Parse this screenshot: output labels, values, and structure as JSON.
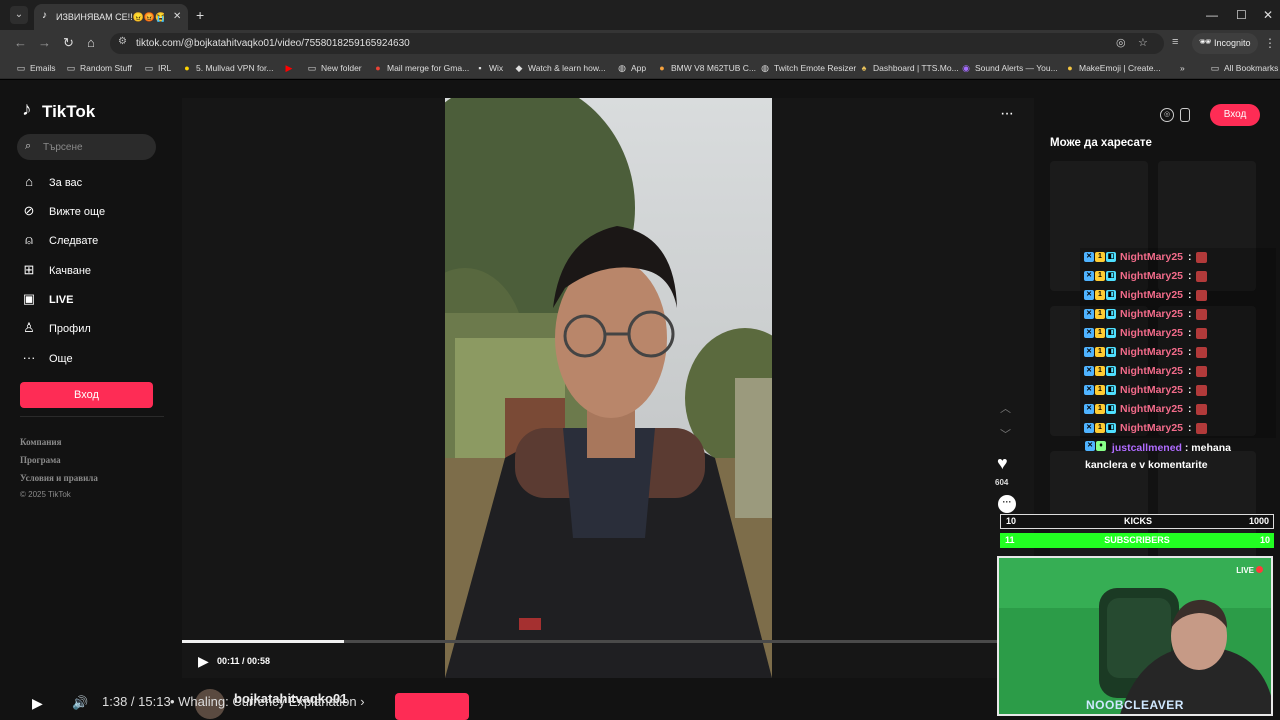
{
  "browser": {
    "tab_title": "ИЗВИНЯВАМ СЕ!!😠😡😭",
    "url": "tiktok.com/@bojkatahitvaqko01/video/7558018259165924630",
    "incognito_label": "Incognito",
    "bookmarks": [
      {
        "label": "Emails",
        "icon": "folder-icon"
      },
      {
        "label": "Random Stuff",
        "icon": "folder-icon"
      },
      {
        "label": "IRL",
        "icon": "folder-icon"
      },
      {
        "label": "5. Mullvad VPN for...",
        "icon": "mullvad-icon"
      },
      {
        "label": "",
        "icon": "youtube-icon"
      },
      {
        "label": "New folder",
        "icon": "folder-icon"
      },
      {
        "label": "Mail merge for Gma...",
        "icon": "mail-merge-icon"
      },
      {
        "label": "Wix",
        "icon": "wix-icon"
      },
      {
        "label": "Watch & learn how...",
        "icon": "watch-icon"
      },
      {
        "label": "App",
        "icon": "globe-icon"
      },
      {
        "label": "BMW V8 M62TUB C...",
        "icon": "bmw-icon"
      },
      {
        "label": "Twitch Emote Resizer",
        "icon": "twitch-icon"
      },
      {
        "label": "Dashboard | TTS.Mo...",
        "icon": "tts-icon"
      },
      {
        "label": "Sound Alerts — You...",
        "icon": "sound-alerts-icon"
      },
      {
        "label": "MakeEmoji | Create...",
        "icon": "makeemoji-icon"
      }
    ],
    "all_bookmarks": "All Bookmarks"
  },
  "sidebar": {
    "logo": "TikTok",
    "search_placeholder": "Търсене",
    "items": [
      {
        "label": "За вас",
        "icon": "home-icon"
      },
      {
        "label": "Вижте още",
        "icon": "compass-icon"
      },
      {
        "label": "Следвате",
        "icon": "following-icon"
      },
      {
        "label": "Качване",
        "icon": "upload-icon"
      },
      {
        "label": "LIVE",
        "icon": "live-icon"
      },
      {
        "label": "Профил",
        "icon": "profile-icon"
      },
      {
        "label": "Още",
        "icon": "more-icon"
      }
    ],
    "login": "Вход",
    "footer": [
      "Компания",
      "Програма",
      "Условия и правила"
    ],
    "copyright": "© 2025 TikTok"
  },
  "video": {
    "likes": "604",
    "time": "00:11 / 00:58",
    "progress": 0.19
  },
  "right": {
    "login": "Вход",
    "suggest_title": "Може да харесате"
  },
  "stream_overlay": {
    "chat": [
      {
        "user": "NightMary25",
        "sep": ":"
      },
      {
        "user": "NightMary25",
        "sep": ":"
      },
      {
        "user": "NightMary25",
        "sep": ":"
      },
      {
        "user": "NightMary25",
        "sep": ":"
      },
      {
        "user": "NightMary25",
        "sep": ":"
      },
      {
        "user": "NightMary25",
        "sep": ":"
      },
      {
        "user": "NightMary25",
        "sep": ":"
      },
      {
        "user": "NightMary25",
        "sep": ":"
      },
      {
        "user": "NightMary25",
        "sep": ":"
      },
      {
        "user": "NightMary25",
        "sep": ":"
      }
    ],
    "last_user": "justcallmened",
    "last_message": ": mehana kanclera e v komentarite",
    "kicks": {
      "left": "10",
      "label": "KICKS",
      "right": "1000"
    },
    "subs": {
      "left": "11",
      "label": "SUBSCRIBERS",
      "right": "10"
    },
    "live": "LIVE",
    "cam_name": "NOOBCLEAVER",
    "player_time": "1:38 / 15:13",
    "chapter": "• Whaling: Currency Explanation ›",
    "behind_name": "bojkatahitvaqko01"
  },
  "colors": {
    "accent": "#fe2c55",
    "subs_green": "#22ff22",
    "chat_user": "#f26b8a",
    "last_user": "#b06cff"
  }
}
